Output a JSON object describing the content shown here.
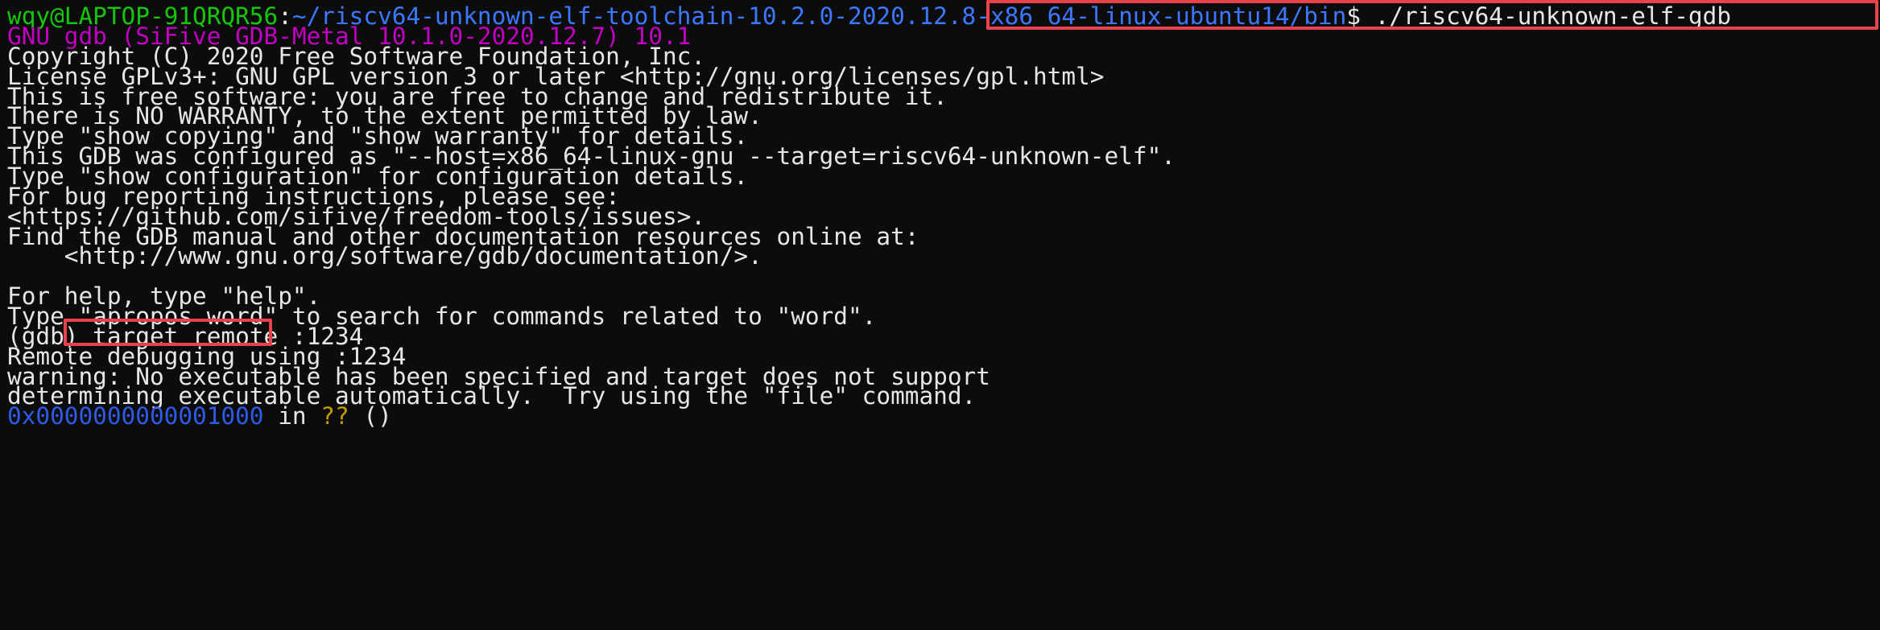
{
  "prompt": {
    "user_host": "wqy@LAPTOP-91QRQR56",
    "colon": ":",
    "path": "~/riscv64-unknown-elf-toolchain-10.2.0-2020.12.8-x86_64-linux-ubuntu14/bin",
    "dollar": "$ ",
    "command": "./riscv64-unknown-elf-gdb"
  },
  "banner": {
    "title": "GNU gdb (SiFive GDB-Metal 10.1.0-2020.12.7) 10.1",
    "lines": [
      "Copyright (C) 2020 Free Software Foundation, Inc.",
      "License GPLv3+: GNU GPL version 3 or later <http://gnu.org/licenses/gpl.html>",
      "This is free software: you are free to change and redistribute it.",
      "There is NO WARRANTY, to the extent permitted by law.",
      "Type \"show copying\" and \"show warranty\" for details.",
      "This GDB was configured as \"--host=x86_64-linux-gnu --target=riscv64-unknown-elf\".",
      "Type \"show configuration\" for configuration details.",
      "For bug reporting instructions, please see:",
      "<https://github.com/sifive/freedom-tools/issues>.",
      "Find the GDB manual and other documentation resources online at:",
      "    <http://www.gnu.org/software/gdb/documentation/>.",
      "",
      "For help, type \"help\".",
      "Type \"apropos word\" to search for commands related to \"word\"."
    ]
  },
  "gdb_prompt": {
    "prefix": "(gdb) ",
    "command": "target remote :1234"
  },
  "output": {
    "lines": [
      "Remote debugging using :1234",
      "warning: No executable has been specified and target does not support",
      "determining executable automatically.  Try using the \"file\" command."
    ],
    "address": "0x0000000000001000",
    "in_word": " in ",
    "unknown_func": "??",
    "parens": " ()"
  },
  "colors": {
    "background": "#0c0c0c",
    "text": "#cccccc",
    "prompt_green": "#16c60c",
    "prompt_blue": "#3b78ff",
    "gdb_magenta": "#c100c1",
    "address_blue": "#2e5be6",
    "unknown_yellow": "#c19c00",
    "highlight_red": "#e8434b"
  }
}
